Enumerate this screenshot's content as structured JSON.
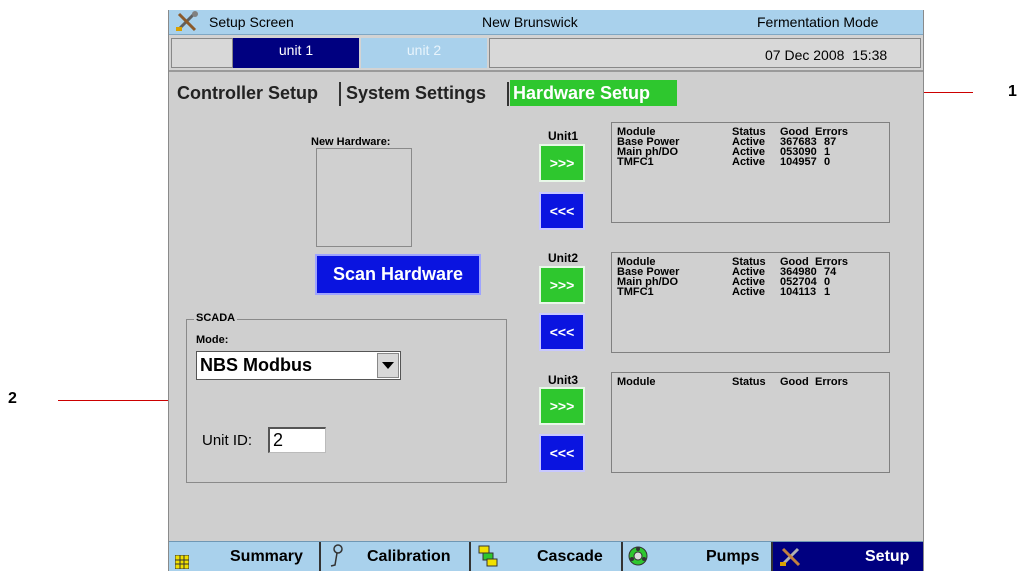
{
  "title_bar": {
    "screen": "Setup Screen",
    "brand": "New Brunswick",
    "mode": "Fermentation Mode"
  },
  "unit_bar": {
    "unit1": "unit 1",
    "unit2": "unit 2",
    "datetime": "07 Dec 2008  15:38"
  },
  "tabs": [
    {
      "label": "Controller Setup"
    },
    {
      "label": "System Settings"
    },
    {
      "label": "Hardware Setup",
      "active": true
    }
  ],
  "new_hardware": {
    "label": "New Hardware:",
    "scan_button": "Scan Hardware"
  },
  "scada": {
    "group_label": "SCADA",
    "mode_label": "Mode:",
    "mode_value": "NBS Modbus",
    "unit_id_label": "Unit ID:",
    "unit_id_value": "2"
  },
  "units": [
    {
      "label": "Unit1",
      "add": ">>>",
      "remove": "<<<",
      "header": {
        "module": "Module",
        "status": "Status",
        "good": "Good",
        "errors": "Errors"
      },
      "rows": [
        {
          "module": "Base Power",
          "status": "Active",
          "good": "367683",
          "errors": "87"
        },
        {
          "module": "Main ph/DO",
          "status": "Active",
          "good": "053090",
          "errors": "1"
        },
        {
          "module": "TMFC1",
          "status": "Active",
          "good": "104957",
          "errors": "0"
        }
      ]
    },
    {
      "label": "Unit2",
      "add": ">>>",
      "remove": "<<<",
      "header": {
        "module": "Module",
        "status": "Status",
        "good": "Good",
        "errors": "Errors"
      },
      "rows": [
        {
          "module": "Base Power",
          "status": "Active",
          "good": "364980",
          "errors": "74"
        },
        {
          "module": "Main ph/DO",
          "status": "Active",
          "good": "052704",
          "errors": "0"
        },
        {
          "module": "TMFC1",
          "status": "Active",
          "good": "104113",
          "errors": "1"
        }
      ]
    },
    {
      "label": "Unit3",
      "add": ">>>",
      "remove": "<<<",
      "header": {
        "module": "Module",
        "status": "Status",
        "good": "Good",
        "errors": "Errors"
      },
      "rows": []
    }
  ],
  "bottom_nav": {
    "summary": "Summary",
    "calibration": "Calibration",
    "cascade": "Cascade",
    "pumps": "Pumps",
    "setup": "Setup"
  },
  "callouts": {
    "one": "1",
    "two": "2"
  },
  "colors": {
    "title_bg": "#a9d1ec",
    "active_tab": "#2ec72e",
    "unit1_bg": "#000080",
    "unit2_bg": "#a9d1ec",
    "blue_button": "#0a14e0",
    "callout_line": "#cc0000"
  }
}
